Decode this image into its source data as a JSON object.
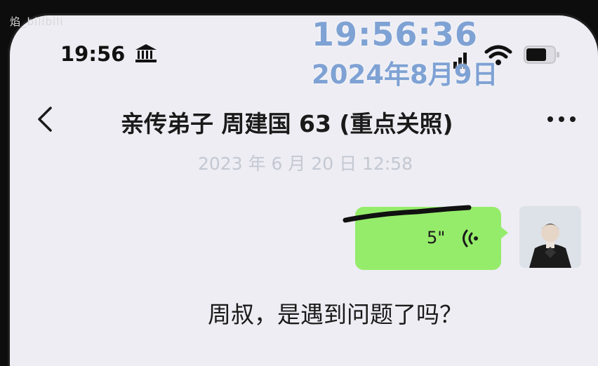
{
  "watermark": "焰_bilibili",
  "status_bar": {
    "time": "19:56",
    "bank_icon": "bank-icon",
    "signal_icon": "signal-icon",
    "wifi_icon": "wifi-icon",
    "battery_icon": "battery-icon"
  },
  "overlay": {
    "clock": "19:56:36",
    "date": "2024年8月9日"
  },
  "header": {
    "back_icon": "chevron-left-icon",
    "title": "亲传弟子 周建国 63 (重点关照)",
    "more_icon": "more-dots-icon"
  },
  "messages": {
    "timestamp": "2023 年 6 月 20 日 12:58",
    "voice": {
      "duration": "5\"",
      "icon": "voice-wave-icon",
      "side": "sent"
    },
    "text": {
      "content": "周叔，是遇到问题了吗？",
      "side": "received"
    }
  },
  "colors": {
    "bubble_sent": "#95ec6a",
    "background": "#ededf3",
    "overlay_text": "#7fa2d4"
  }
}
